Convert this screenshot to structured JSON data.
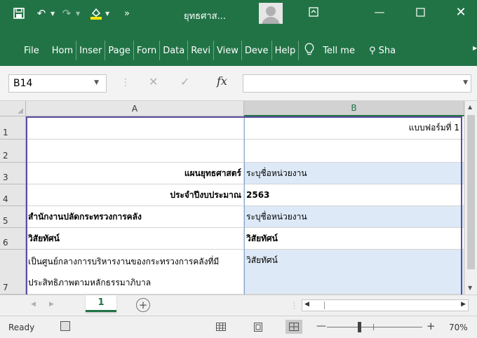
{
  "window": {
    "title": "ยุทธศาส...",
    "controls": [
      "minimize-icon",
      "restore-icon",
      "close-icon"
    ]
  },
  "ribbon": {
    "tabs": [
      "File",
      "Hom",
      "Inser",
      "Page",
      "Forn",
      "Data",
      "Revi",
      "View",
      "Deve",
      "Help"
    ],
    "tell_me": "Tell me",
    "share": "Sha"
  },
  "formula_bar": {
    "name_box": "B14",
    "fx_label": "fx",
    "formula": ""
  },
  "sheet": {
    "columns": [
      "A",
      "B"
    ],
    "selected_column": "B",
    "rows": [
      {
        "num": "1",
        "a": "",
        "b": "แบบฟอร์มที่ 1"
      },
      {
        "num": "2",
        "a": "",
        "b": ""
      },
      {
        "num": "3",
        "a": "แผนยุทธศาสตร์",
        "b": "ระบุชื่อหน่วยงาน"
      },
      {
        "num": "4",
        "a": "ประจำปีงบประมาณ",
        "b": "2563"
      },
      {
        "num": "5",
        "a": "สำนักงานปลัดกระทรวงการคลัง",
        "b": "ระบุชื่อหน่วยงาน"
      },
      {
        "num": "6",
        "a": "วิสัยทัศน์",
        "b": "วิสัยทัศน์"
      },
      {
        "num": "7",
        "a_line1": "เป็นศูนย์กลางการบริหารงานของกระทรวงการคลังที่มี",
        "a_line2": "ประสิทธิภาพตามหลักธรรมาภิบาล",
        "b": "วิสัยทัศน์"
      }
    ],
    "fill_color": "#dde9f6",
    "outline_color": "#5b4ea3"
  },
  "sheet_tabs": {
    "active": "1",
    "add_label": "+"
  },
  "status": {
    "ready": "Ready",
    "zoom": "70%"
  },
  "theme": {
    "accent": "#217346"
  }
}
